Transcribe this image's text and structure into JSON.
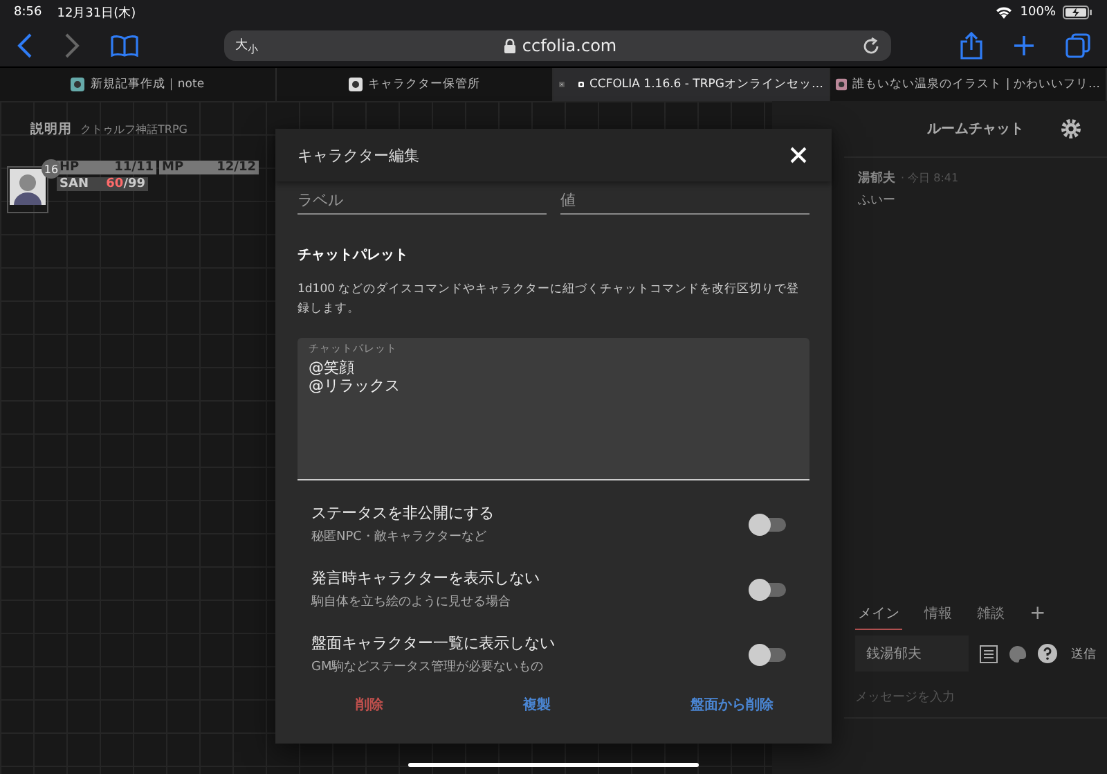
{
  "status_bar": {
    "time": "8:56",
    "date": "12月31日(木)",
    "battery": "100%"
  },
  "browser": {
    "text_size": "大$_{小}$",
    "url": "ccfolia.com"
  },
  "tabs": [
    {
      "label": "新規記事作成｜note",
      "selected": false
    },
    {
      "label": "キャラクター保管所",
      "selected": false
    },
    {
      "label": "CCFOLIA 1.16.6 - TRPGオンラインセッ…",
      "selected": true
    },
    {
      "label": "誰もいない温泉のイラスト | かわいいフリ…",
      "selected": false
    }
  ],
  "room": {
    "title": "説明用",
    "subtitle": "クトゥルフ神話TRPG"
  },
  "character": {
    "initiative": "16",
    "stats": [
      {
        "label": "HP",
        "value": "11/11"
      },
      {
        "label": "MP",
        "value": "12/12"
      }
    ],
    "san": {
      "label": "SAN",
      "current": "60",
      "max": "/99"
    }
  },
  "chat": {
    "title": "ルームチャット",
    "messages": [
      {
        "name": "湯郁夫",
        "time": "· 今日 8:41",
        "text": "ふいー"
      }
    ],
    "tabs": [
      {
        "label": "メイン",
        "selected": true
      },
      {
        "label": "情報",
        "selected": false
      },
      {
        "label": "雑談",
        "selected": false
      }
    ],
    "add": "+",
    "speaker": "銭湯郁夫",
    "placeholder": "メッセージを入力",
    "send": "送信"
  },
  "modal": {
    "title": "キャラクター編集",
    "fields": [
      {
        "placeholder": "ラベル"
      },
      {
        "placeholder": "値"
      }
    ],
    "section": "チャットパレット",
    "description": "1d100 などのダイスコマンドやキャラクターに紐づくチャットコマンドを改行区切りで登録します。",
    "palette": {
      "label": "チャットパレット",
      "value": "@笑顔\n@リラックス"
    },
    "toggles": [
      {
        "label": "ステータスを非公開にする",
        "hint": "秘匿NPC・敵キャラクターなど",
        "on": false
      },
      {
        "label": "発言時キャラクターを表示しない",
        "hint": "駒自体を立ち絵のように見せる場合",
        "on": false
      },
      {
        "label": "盤面キャラクター一覧に表示しない",
        "hint": "GM駒などステータス管理が必要ないもの",
        "on": false
      }
    ],
    "actions": [
      {
        "label": "削除",
        "kind": "danger"
      },
      {
        "label": "複製",
        "kind": "normal"
      },
      {
        "label": "盤面から削除",
        "kind": "normal"
      }
    ]
  }
}
